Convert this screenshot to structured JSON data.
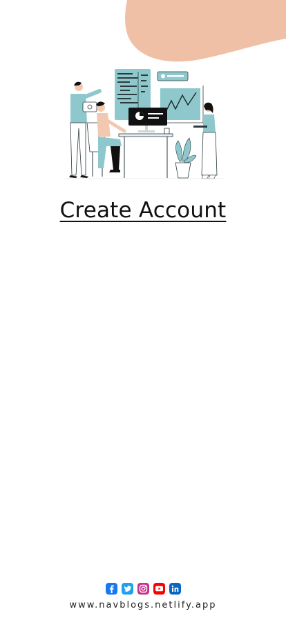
{
  "header": {
    "decor_color": "#EFC0A6"
  },
  "hero": {
    "illustration": "team-working-on-analytics-illustration",
    "accent_color": "#8FC8CC"
  },
  "page": {
    "title": "Create Account"
  },
  "footer": {
    "social_icons": [
      {
        "name": "facebook-icon",
        "color": "#1877F2"
      },
      {
        "name": "twitter-icon",
        "color": "#1DA1F2"
      },
      {
        "name": "instagram-icon",
        "color": "#C1358B"
      },
      {
        "name": "youtube-icon",
        "color": "#FF0000"
      },
      {
        "name": "linkedin-icon",
        "color": "#0A66C2"
      }
    ],
    "url": "www.navblogs.netlify.app"
  }
}
